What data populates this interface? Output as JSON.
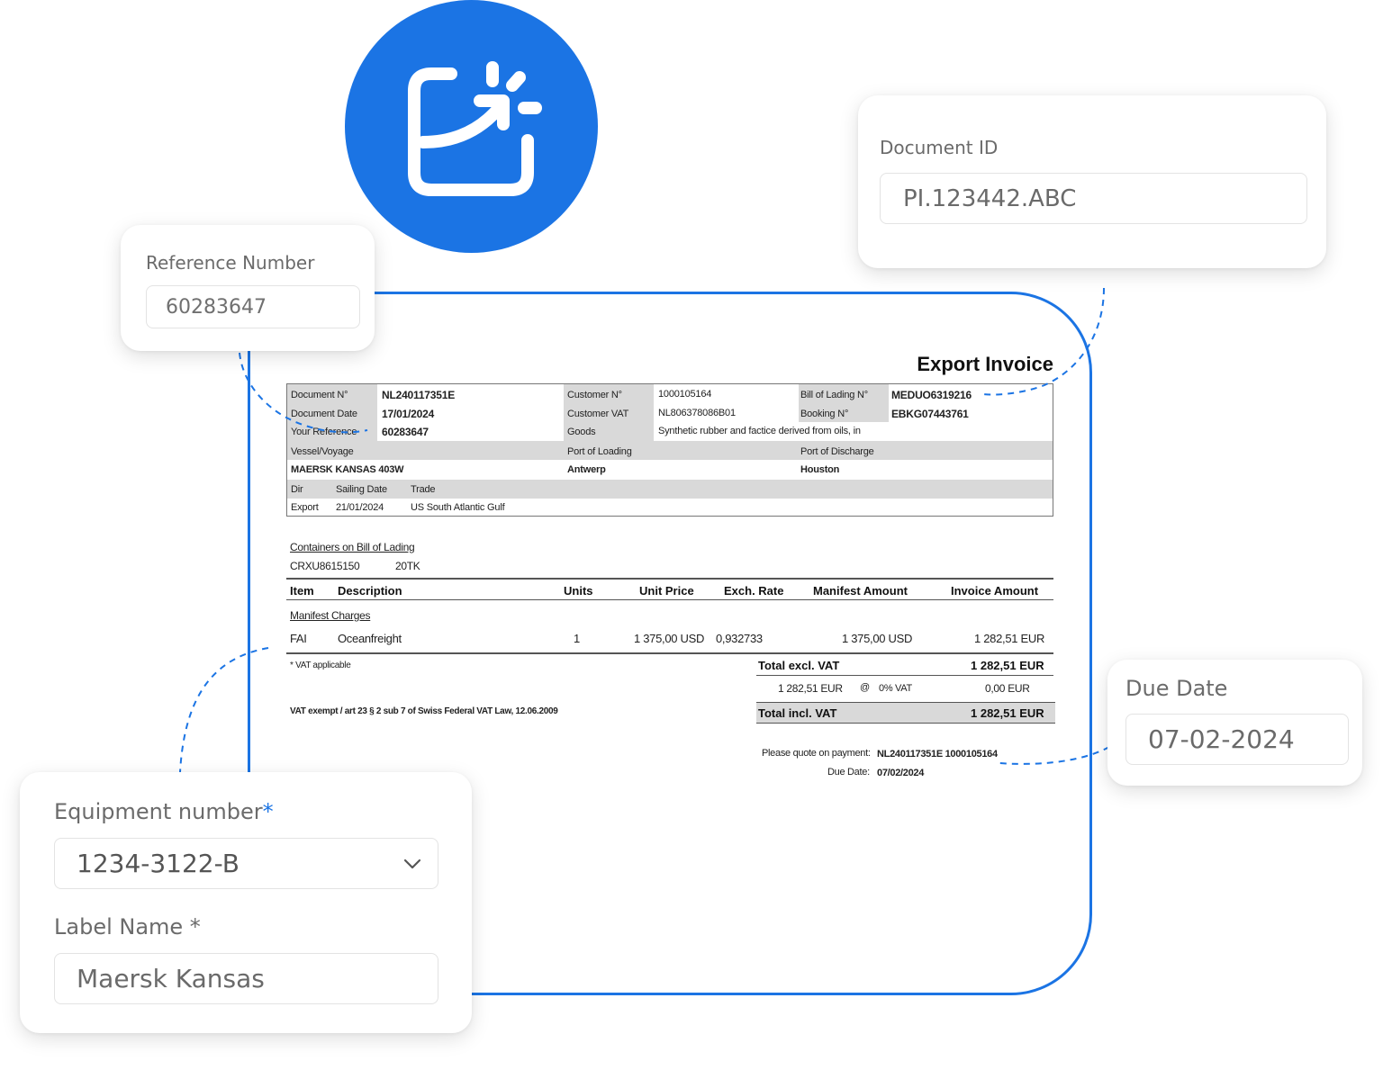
{
  "reference_card": {
    "label": "Reference Number",
    "value": "60283647"
  },
  "document_card": {
    "label": "Document ID",
    "value": "PI.123442.ABC"
  },
  "due_card": {
    "label": "Due Date",
    "value": "07-02-2024"
  },
  "equipment_card": {
    "equipment_label": "Equipment number",
    "required_mark": "*",
    "equipment_value": "1234-3122-B",
    "label_name_label": "Label Name *",
    "label_name_value": "Maersk Kansas"
  },
  "icon": "export-sparkle-icon",
  "colors": {
    "accent": "#1b74e4"
  },
  "invoice": {
    "title": "Export Invoice",
    "header": {
      "doc_no_label": "Document N°",
      "doc_no": "NL240117351E",
      "doc_date_label": "Document Date",
      "doc_date": "17/01/2024",
      "your_ref_label": "Your Reference",
      "your_ref": "60283647",
      "cust_no_label": "Customer N°",
      "cust_no": "1000105164",
      "cust_vat_label": "Customer VAT",
      "cust_vat": "NL806378086B01",
      "goods_label": "Goods",
      "goods": "Synthetic rubber and factice derived from oils, in",
      "bol_label": "Bill of Lading N°",
      "bol": "MEDUO6319216",
      "booking_label": "Booking N°",
      "booking": "EBKG07443761",
      "vessel_label": "Vessel/Voyage",
      "vessel": "MAERSK KANSAS 403W",
      "pol_label": "Port of Loading",
      "pol": "Antwerp",
      "pod_label": "Port of Discharge",
      "pod": "Houston",
      "dir_label": "Dir",
      "dir": "Export",
      "sailing_label": "Sailing Date",
      "sailing": "21/01/2024",
      "trade_label": "Trade",
      "trade": "US South Atlantic Gulf"
    },
    "containers_title": "Containers on Bill of Lading",
    "container_no": "CRXU8615150",
    "container_type": "20TK",
    "columns": {
      "item": "Item",
      "description": "Description",
      "units": "Units",
      "unit_price": "Unit Price",
      "exch_rate": "Exch. Rate",
      "manifest_amount": "Manifest Amount",
      "invoice_amount": "Invoice Amount"
    },
    "section": "Manifest Charges",
    "row": {
      "item": "FAI",
      "description": "Oceanfreight",
      "units": "1",
      "unit_price": "1 375,00 USD",
      "exch_rate": "0,932733",
      "manifest_amount": "1 375,00 USD",
      "invoice_amount": "1 282,51 EUR"
    },
    "vat_note": "* VAT applicable",
    "total_excl_label": "Total excl. VAT",
    "total_excl": "1 282,51 EUR",
    "vat_base": "1 282,51  EUR",
    "vat_at": "@",
    "vat_rate": "0% VAT",
    "vat_amount": "0,00 EUR",
    "vat_exempt": "VAT exempt / art 23 § 2 sub 7 of Swiss Federal VAT Law, 12.06.2009",
    "total_incl_label": "Total incl. VAT",
    "total_incl": "1 282,51 EUR",
    "quote_label": "Please quote on payment:",
    "quote_value": "NL240117351E  1000105164",
    "due_label": "Due Date:",
    "due_value": "07/02/2024"
  }
}
